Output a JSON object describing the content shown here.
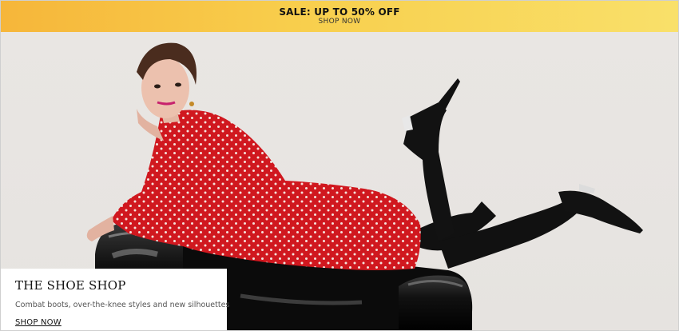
{
  "promo_banner": {
    "title": "SALE: UP TO 50% OFF",
    "cta": "SHOP NOW",
    "colors": {
      "start": "#f6b63a",
      "end": "#f9e06a"
    }
  },
  "hero": {
    "image_alt": "Model in red polka-dot dress and black over-the-knee boots lying on a black chair",
    "card": {
      "title": "THE SHOE SHOP",
      "description": "Combat boots, over-the-knee styles and new silhouettes",
      "cta": "SHOP NOW"
    }
  }
}
